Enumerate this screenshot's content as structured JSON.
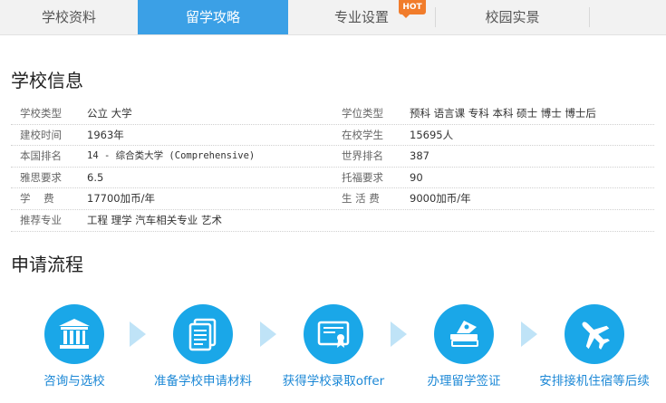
{
  "tabs": [
    {
      "label": "学校资料"
    },
    {
      "label": "留学攻略"
    },
    {
      "label": "专业设置",
      "badge": "HOT"
    },
    {
      "label": "校园实景"
    }
  ],
  "active_tab": "留学攻略",
  "school_info": {
    "title": "学校信息",
    "rows": [
      {
        "label1": "学校类型",
        "value1": "公立 大学",
        "label2": "学位类型",
        "value2": "预科 语言课 专科 本科 硕士 博士 博士后"
      },
      {
        "label1": "建校时间",
        "value1": "1963年",
        "label2": "在校学生",
        "value2": "15695人"
      },
      {
        "label1": "本国排名",
        "value1": "14 - 综合类大学 (Comprehensive)",
        "label2": "世界排名",
        "value2": "387"
      },
      {
        "label1": "雅思要求",
        "value1": "6.5",
        "label2": "托福要求",
        "value2": "90"
      },
      {
        "label1": "学    费",
        "value1": "17700加币/年",
        "label2": "生 活 费",
        "value2": "9000加币/年"
      },
      {
        "label1": "推荐专业",
        "value1": "工程 理学 汽车相关专业 艺术",
        "label2": "",
        "value2": ""
      }
    ]
  },
  "process": {
    "title": "申请流程",
    "steps": [
      {
        "label": "咨询与选校",
        "icon": "institution-icon"
      },
      {
        "label": "准备学校申请材料",
        "icon": "documents-icon"
      },
      {
        "label": "获得学校录取offer",
        "icon": "certificate-icon"
      },
      {
        "label": "办理留学签证",
        "icon": "passport-icon"
      },
      {
        "label": "安排接机住宿等后续",
        "icon": "airplane-icon"
      }
    ]
  },
  "colors": {
    "active_tab": "#3ba0e6",
    "hot_badge": "#f17c2b",
    "step_circle": "#1aa7e8",
    "step_label": "#1c88d6",
    "arrow": "#bfe3f7"
  }
}
